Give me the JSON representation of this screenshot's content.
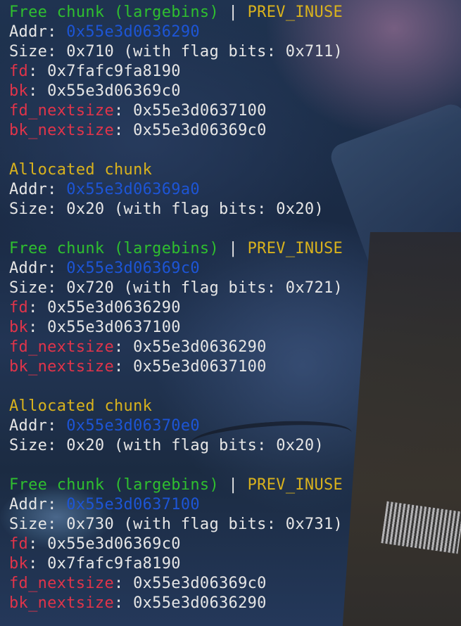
{
  "colors": {
    "free_chunk": "#2fbf2f",
    "allocated_chunk": "#d9b21d",
    "prev_inuse": "#d9b21d",
    "address": "#1d55d6",
    "pointer_label": "#e0344a",
    "text": "#e6e6e6"
  },
  "chunks": [
    {
      "status": "Free chunk (largebins)",
      "sep": " | ",
      "flag": "PREV_INUSE",
      "addr_label": "Addr: ",
      "addr": "0x55e3d0636290",
      "size_text": "Size: 0x710 (with flag bits: 0x711)",
      "fd_label": "fd",
      "fd": ": 0x7fafc9fa8190",
      "bk_label": "bk",
      "bk": ": 0x55e3d06369c0",
      "fd_nextsize_label": "fd_nextsize",
      "fd_nextsize": ": 0x55e3d0637100",
      "bk_nextsize_label": "bk_nextsize",
      "bk_nextsize": ": 0x55e3d06369c0"
    },
    {
      "status": "Allocated chunk",
      "addr_label": "Addr: ",
      "addr": "0x55e3d06369a0",
      "size_text": "Size: 0x20 (with flag bits: 0x20)"
    },
    {
      "status": "Free chunk (largebins)",
      "sep": " | ",
      "flag": "PREV_INUSE",
      "addr_label": "Addr: ",
      "addr": "0x55e3d06369c0",
      "size_text": "Size: 0x720 (with flag bits: 0x721)",
      "fd_label": "fd",
      "fd": ": 0x55e3d0636290",
      "bk_label": "bk",
      "bk": ": 0x55e3d0637100",
      "fd_nextsize_label": "fd_nextsize",
      "fd_nextsize": ": 0x55e3d0636290",
      "bk_nextsize_label": "bk_nextsize",
      "bk_nextsize": ": 0x55e3d0637100"
    },
    {
      "status": "Allocated chunk",
      "addr_label": "Addr: ",
      "addr": "0x55e3d06370e0",
      "size_text": "Size: 0x20 (with flag bits: 0x20)"
    },
    {
      "status": "Free chunk (largebins)",
      "sep": " | ",
      "flag": "PREV_INUSE",
      "addr_label": "Addr: ",
      "addr": "0x55e3d0637100",
      "size_text": "Size: 0x730 (with flag bits: 0x731)",
      "fd_label": "fd",
      "fd": ": 0x55e3d06369c0",
      "bk_label": "bk",
      "bk": ": 0x7fafc9fa8190",
      "fd_nextsize_label": "fd_nextsize",
      "fd_nextsize": ": 0x55e3d06369c0",
      "bk_nextsize_label": "bk_nextsize",
      "bk_nextsize": ": 0x55e3d0636290"
    }
  ]
}
